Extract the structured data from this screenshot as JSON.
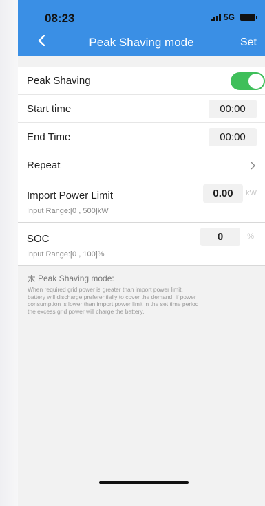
{
  "status": {
    "time": "08:23",
    "network": "5G"
  },
  "nav": {
    "title": "Peak Shaving mode",
    "set_label": "Set"
  },
  "rows": {
    "peak_shaving": {
      "label": "Peak Shaving",
      "enabled": true
    },
    "start_time": {
      "label": "Start time",
      "value": "00:00"
    },
    "end_time": {
      "label": "End Time",
      "value": "00:00"
    },
    "repeat": {
      "label": "Repeat"
    },
    "import_power": {
      "label": "Import Power Limit",
      "value": "0.00",
      "unit": "kW",
      "hint": "Input Range:[0 , 500]kW"
    },
    "soc": {
      "label": "SOC",
      "value": "0",
      "unit": "%",
      "hint": "Input Range:[0 , 100]%"
    }
  },
  "note": {
    "title": "Peak Shaving mode:",
    "lines": [
      "When required grid power is greater than import power limit,",
      "battery will discharge preferentially to cover the demand; if power",
      "consumption is lower than import power limit in the set time period",
      "the excess grid power will charge the battery."
    ]
  },
  "colors": {
    "header": "#3a8fe5",
    "toggle_on": "#3fbf5a"
  }
}
